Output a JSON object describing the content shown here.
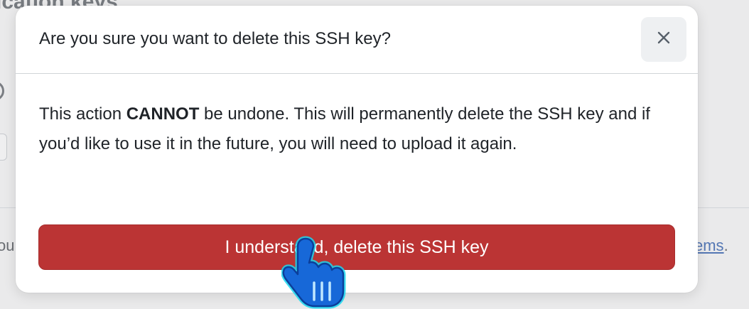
{
  "background": {
    "heading_fragment": "ication keys",
    "left_text_fragment": "ou",
    "link_fragment": "ems",
    "link_period": "."
  },
  "dialog": {
    "title": "Are you sure you want to delete this SSH key?",
    "close_icon": "close-icon",
    "body": {
      "part1": "This action ",
      "emphasis": "CANNOT",
      "part2": " be undone. This will permanently delete the SSH key and if you’d like to use it in the future, you will need to upload it again."
    },
    "confirm_label": "I understand, delete this SSH key"
  },
  "colors": {
    "danger": "#bb3434",
    "link": "#5477b4",
    "cursor_glow": "#19d8f0"
  },
  "cursor": "hand-pointer-icon"
}
